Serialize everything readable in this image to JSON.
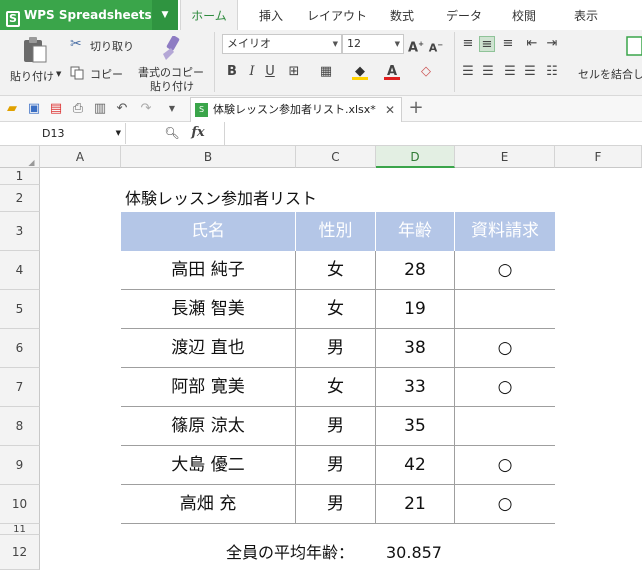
{
  "app": {
    "name": "WPS Spreadsheets",
    "logo_letter": "S"
  },
  "tabs": [
    "ホーム",
    "挿入",
    "レイアウト",
    "数式",
    "データ",
    "校閲",
    "表示"
  ],
  "active_tab": "ホーム",
  "ribbon": {
    "paste_label": "貼り付け",
    "cut_label": "切り取り",
    "copy_label": "コピー",
    "format_copy_label_1": "書式のコピー",
    "format_copy_label_2": "貼り付け",
    "font_name": "メイリオ",
    "font_size": "12",
    "merge_label": "セルを結合し"
  },
  "document_tab": {
    "title": "体験レッスン参加者リスト.xlsx*"
  },
  "formula_bar": {
    "name_box": "D13",
    "fx_label": "fx",
    "formula": ""
  },
  "columns": [
    "A",
    "B",
    "C",
    "D",
    "E",
    "F"
  ],
  "selected_column": "D",
  "rows": [
    "1",
    "2",
    "3",
    "4",
    "5",
    "6",
    "7",
    "8",
    "9",
    "10",
    "11",
    "12"
  ],
  "sheet": {
    "title": "体験レッスン参加者リスト",
    "headers": [
      "氏名",
      "性別",
      "年齢",
      "資料請求"
    ],
    "records": [
      {
        "name": "高田 純子",
        "gender": "女",
        "age": "28",
        "request": "○"
      },
      {
        "name": "長瀬 智美",
        "gender": "女",
        "age": "19",
        "request": ""
      },
      {
        "name": "渡辺 直也",
        "gender": "男",
        "age": "38",
        "request": "○"
      },
      {
        "name": "阿部 寛美",
        "gender": "女",
        "age": "33",
        "request": "○"
      },
      {
        "name": "篠原 涼太",
        "gender": "男",
        "age": "35",
        "request": ""
      },
      {
        "name": "大島 優二",
        "gender": "男",
        "age": "42",
        "request": "○"
      },
      {
        "name": "高畑 充",
        "gender": "男",
        "age": "21",
        "request": "○"
      }
    ],
    "average_label": "全員の平均年齢：",
    "average_value": "30.857"
  },
  "colors": {
    "brand": "#3aa54a",
    "header_fill": "#b4c6e7"
  }
}
